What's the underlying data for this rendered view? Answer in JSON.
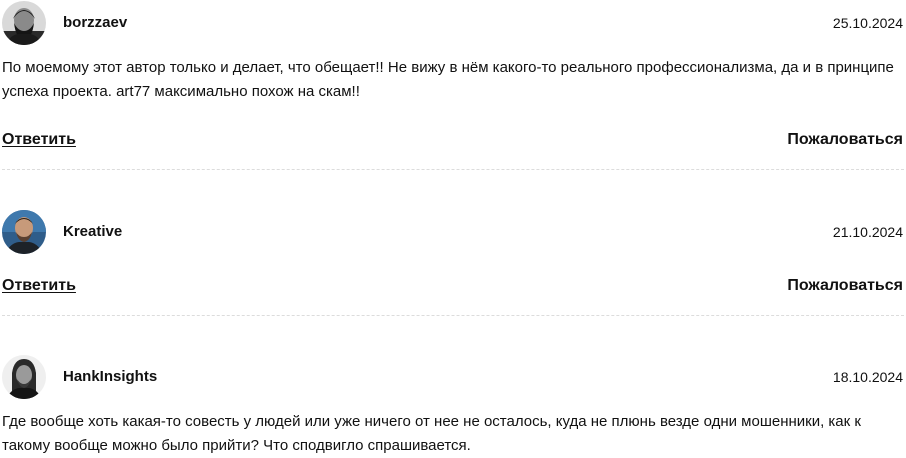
{
  "comments": [
    {
      "author": "borzzaev",
      "date": "25.10.2024",
      "avatar_icon": "bearded-man-avatar",
      "text": "По моемому этот автор только и делает, что обещает!! Не вижу в нём какого-то реального профессионализма, да и в принципе успеха проекта. art77 максимально похож на скам!!",
      "reply_label": "Ответить",
      "report_label": "Пожаловаться"
    },
    {
      "author": "Kreative",
      "date": "21.10.2024",
      "avatar_icon": "man-portrait-avatar",
      "text": "",
      "reply_label": "Ответить",
      "report_label": "Пожаловаться"
    },
    {
      "author": "HankInsights",
      "date": "18.10.2024",
      "avatar_icon": "long-hair-man-avatar",
      "text": "Где вообще хоть какая-то совесть у людей или уже ничего от нее не осталось, куда не плюнь везде одни мошенники, как к такому вообще можно было прийти? Что сподвигло спрашивается.",
      "reply_label": "Ответить",
      "report_label": "Пожаловаться"
    }
  ]
}
